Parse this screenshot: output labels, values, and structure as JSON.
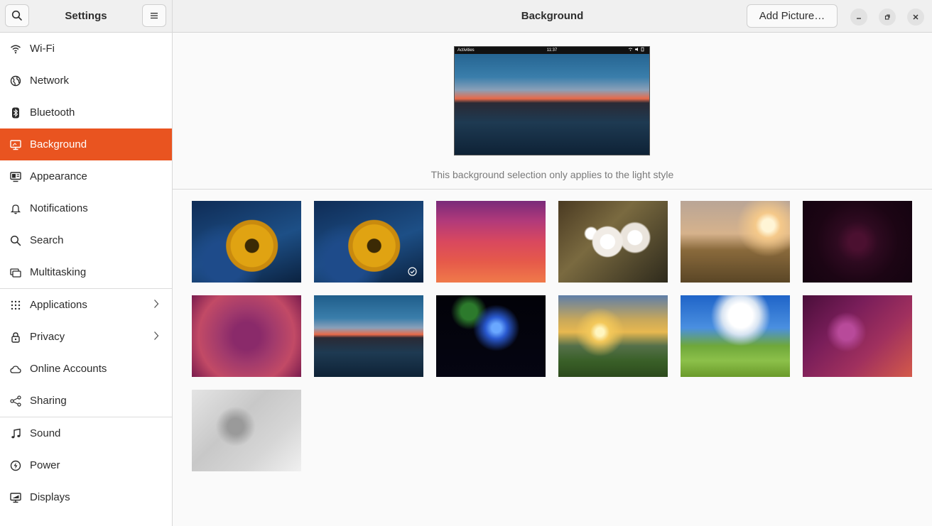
{
  "sidebar": {
    "title": "Settings",
    "items": [
      {
        "label": "Wi-Fi",
        "icon": "wifi-icon",
        "active": false,
        "chevron": false,
        "sep_after": false
      },
      {
        "label": "Network",
        "icon": "globe-icon",
        "active": false,
        "chevron": false,
        "sep_after": false
      },
      {
        "label": "Bluetooth",
        "icon": "bluetooth-icon",
        "active": false,
        "chevron": false,
        "sep_after": false
      },
      {
        "label": "Background",
        "icon": "monitor-icon",
        "active": true,
        "chevron": false,
        "sep_after": false
      },
      {
        "label": "Appearance",
        "icon": "appearance-icon",
        "active": false,
        "chevron": false,
        "sep_after": false
      },
      {
        "label": "Notifications",
        "icon": "bell-icon",
        "active": false,
        "chevron": false,
        "sep_after": false
      },
      {
        "label": "Search",
        "icon": "search-icon",
        "active": false,
        "chevron": false,
        "sep_after": false
      },
      {
        "label": "Multitasking",
        "icon": "multitasking-icon",
        "active": false,
        "chevron": false,
        "sep_after": true
      },
      {
        "label": "Applications",
        "icon": "apps-grid-icon",
        "active": false,
        "chevron": true,
        "sep_after": false
      },
      {
        "label": "Privacy",
        "icon": "lock-icon",
        "active": false,
        "chevron": true,
        "sep_after": false
      },
      {
        "label": "Online Accounts",
        "icon": "cloud-icon",
        "active": false,
        "chevron": false,
        "sep_after": false
      },
      {
        "label": "Sharing",
        "icon": "share-icon",
        "active": false,
        "chevron": false,
        "sep_after": true
      },
      {
        "label": "Sound",
        "icon": "music-note-icon",
        "active": false,
        "chevron": false,
        "sep_after": false
      },
      {
        "label": "Power",
        "icon": "power-icon",
        "active": false,
        "chevron": false,
        "sep_after": false
      },
      {
        "label": "Displays",
        "icon": "display-icon",
        "active": false,
        "chevron": false,
        "sep_after": false
      }
    ]
  },
  "header": {
    "title": "Background",
    "add_picture_label": "Add Picture…"
  },
  "preview": {
    "topbar_activities": "Activities",
    "topbar_clock": "11:37",
    "caption": "This background selection only applies to the light style"
  },
  "wallpapers": [
    {
      "name": "wallpaper-flower-1",
      "style": "t-flower",
      "selected": false
    },
    {
      "name": "wallpaper-flower-2",
      "style": "t-flower",
      "selected": true
    },
    {
      "name": "wallpaper-waves",
      "style": "t-wave",
      "selected": false
    },
    {
      "name": "wallpaper-blossom",
      "style": "t-blossom",
      "selected": false
    },
    {
      "name": "wallpaper-field-sunset",
      "style": "t-field",
      "selected": false
    },
    {
      "name": "wallpaper-jellyfish-dark",
      "style": "t-jelly-dark",
      "selected": false
    },
    {
      "name": "wallpaper-jellyfish-purple",
      "style": "t-jelly-purple",
      "selected": false
    },
    {
      "name": "wallpaper-lake-sunset",
      "style": "t-lake",
      "selected": false
    },
    {
      "name": "wallpaper-blue-jellyfish",
      "style": "t-blue-jelly",
      "selected": false
    },
    {
      "name": "wallpaper-mountain-sunrise",
      "style": "t-mountain",
      "selected": false
    },
    {
      "name": "wallpaper-meadow",
      "style": "t-meadow",
      "selected": false
    },
    {
      "name": "wallpaper-jellyfish-magenta",
      "style": "t-jelly-magenta",
      "selected": false
    },
    {
      "name": "wallpaper-jellyfish-gray",
      "style": "t-gray",
      "selected": false
    }
  ],
  "colors": {
    "accent": "#e95420"
  }
}
